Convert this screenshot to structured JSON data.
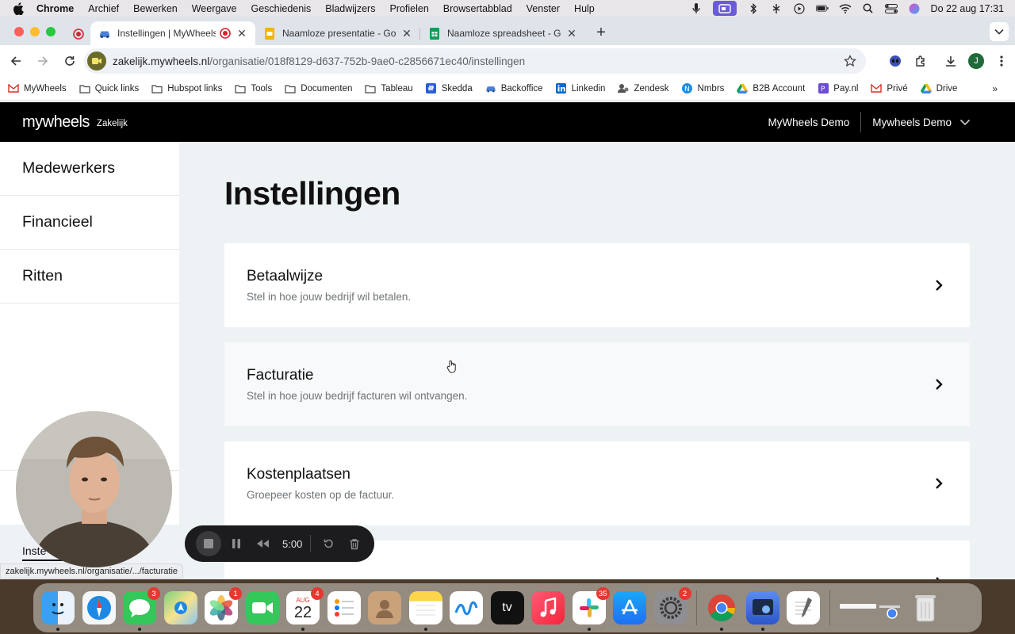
{
  "menubar": {
    "app": "Chrome",
    "items": [
      "Archief",
      "Bewerken",
      "Weergave",
      "Geschiedenis",
      "Bladwijzers",
      "Profielen",
      "Browsertabblad",
      "Venster",
      "Hulp"
    ],
    "clock": "Do 22 aug  17:31"
  },
  "tabs": [
    {
      "title": "Instellingen | MyWheels Zakelijk",
      "active": true
    },
    {
      "title": "Naamloze presentatie - Google Presentaties",
      "active": false
    },
    {
      "title": "Naamloze spreadsheet - Google Spreadsheets",
      "active": false
    }
  ],
  "address": {
    "domain": "zakelijk.mywheels.nl",
    "path": "/organisatie/018f8129-d637-752b-9ae0-c2856671ec40/instellingen"
  },
  "profile_initial": "J",
  "bookmarks": [
    {
      "label": "MyWheels",
      "icon": "gmail-icon"
    },
    {
      "label": "Quick links",
      "icon": "folder-icon"
    },
    {
      "label": "Hubspot links",
      "icon": "folder-icon"
    },
    {
      "label": "Tools",
      "icon": "folder-icon"
    },
    {
      "label": "Documenten",
      "icon": "folder-icon"
    },
    {
      "label": "Tableau",
      "icon": "folder-icon"
    },
    {
      "label": "Skedda",
      "icon": "skedda-icon"
    },
    {
      "label": "Backoffice",
      "icon": "car-icon"
    },
    {
      "label": "Linkedin",
      "icon": "linkedin-icon"
    },
    {
      "label": "Zendesk",
      "icon": "zendesk-icon"
    },
    {
      "label": "Nmbrs",
      "icon": "nmbrs-icon"
    },
    {
      "label": "B2B Account",
      "icon": "drive-icon"
    },
    {
      "label": "Pay.nl",
      "icon": "paynl-icon"
    },
    {
      "label": "Privé",
      "icon": "gmail-icon"
    },
    {
      "label": "Drive",
      "icon": "drive-icon"
    }
  ],
  "app": {
    "logo": "mywheels",
    "logo_sub": "Zakelijk",
    "account_name": "MyWheels Demo",
    "org_name": "Mywheels Demo"
  },
  "sidebar": {
    "items": [
      {
        "label": "Medewerkers"
      },
      {
        "label": "Financieel"
      },
      {
        "label": "Ritten"
      }
    ],
    "bottom_label": "Inste"
  },
  "main": {
    "title": "Instellingen",
    "cards": [
      {
        "title": "Betaalwijze",
        "desc": "Stel in hoe jouw bedrijf wil betalen."
      },
      {
        "title": "Facturatie",
        "desc": "Stel in hoe jouw bedrijf facturen wil ontvangen."
      },
      {
        "title": "Kostenplaatsen",
        "desc": "Groepeer kosten op de factuur."
      }
    ]
  },
  "statusbar": {
    "url": "zakelijk.mywheels.nl/organisatie/.../facturatie"
  },
  "recorder": {
    "time": "5:00"
  },
  "dock": {
    "apps": [
      {
        "name": "finder",
        "badge": ""
      },
      {
        "name": "safari",
        "badge": ""
      },
      {
        "name": "messages",
        "badge": "3"
      },
      {
        "name": "maps",
        "badge": ""
      },
      {
        "name": "photos",
        "badge": "1"
      },
      {
        "name": "facetime",
        "badge": ""
      },
      {
        "name": "calendar",
        "badge": "4",
        "month": "AUG",
        "day": "22"
      },
      {
        "name": "reminders",
        "badge": ""
      },
      {
        "name": "contacts",
        "badge": ""
      },
      {
        "name": "notes",
        "badge": ""
      },
      {
        "name": "freeform",
        "badge": ""
      },
      {
        "name": "apple-tv",
        "badge": "",
        "label": "tv"
      },
      {
        "name": "music",
        "badge": ""
      },
      {
        "name": "slack",
        "badge": "35"
      },
      {
        "name": "app-store",
        "badge": ""
      },
      {
        "name": "system-settings",
        "badge": "2"
      },
      {
        "name": "chrome",
        "badge": ""
      },
      {
        "name": "preview",
        "badge": ""
      },
      {
        "name": "textedit",
        "badge": ""
      }
    ]
  },
  "colors": {
    "app_header": "#000000",
    "content_bg": "#edf2f4",
    "card_bg": "#ffffff",
    "accent_menubar": "#6a5cd6"
  }
}
